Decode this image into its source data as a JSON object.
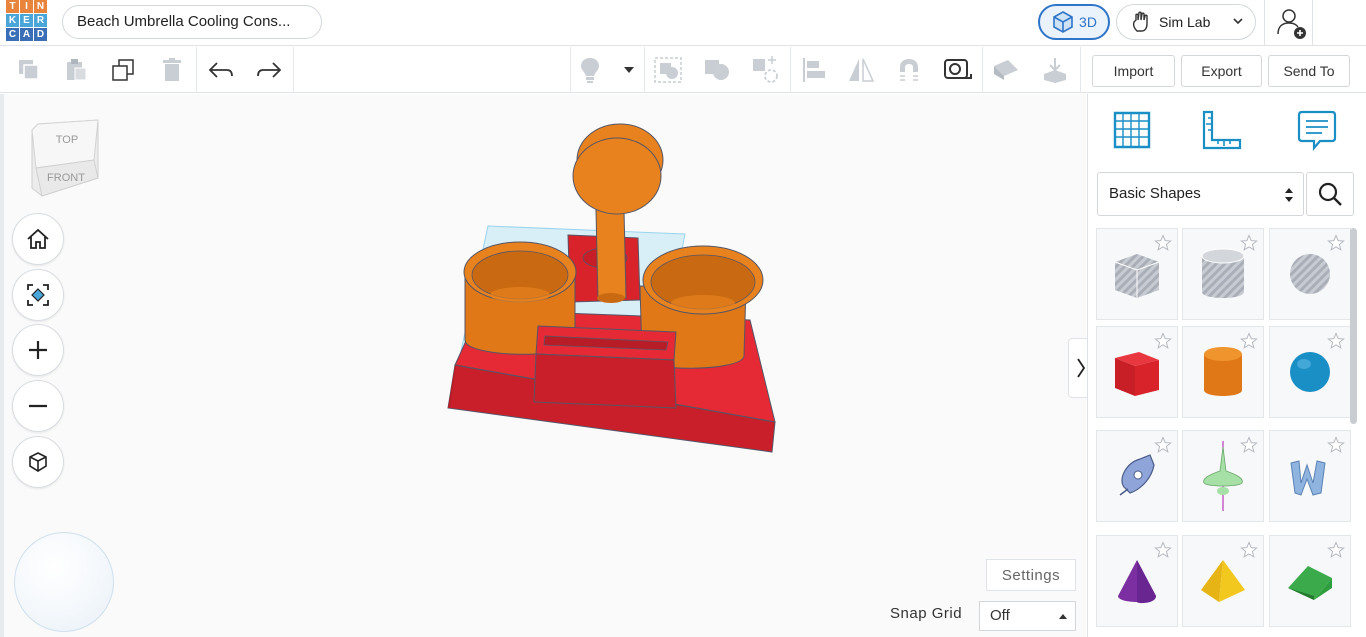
{
  "app": {
    "logo_letters": [
      "T",
      "I",
      "N",
      "K",
      "E",
      "R",
      "C",
      "A",
      "D"
    ],
    "logo_colors": [
      "#e8843c",
      "#e8843c",
      "#e8843c",
      "#4aa5d8",
      "#4aa5d8",
      "#4aa5d8",
      "#3a6fb7",
      "#3a6fb7",
      "#3a6fb7"
    ],
    "design_title": "Beach Umbrella Cooling Cons..."
  },
  "header": {
    "view_3d_label": "3D",
    "sim_lab_label": "Sim Lab",
    "icons": [
      "cube-icon",
      "hand-icon",
      "chevron-down-icon",
      "user-add-icon"
    ]
  },
  "toolbar": {
    "icons_left": [
      "copy-icon",
      "paste-icon",
      "duplicate-icon",
      "delete-icon",
      "undo-icon",
      "redo-icon"
    ],
    "icons_right": [
      "light-bulb-icon",
      "dropdown-caret-icon",
      "group-icon",
      "ungroup-icon",
      "cruise-icon",
      "align-icon",
      "mirror-icon",
      "magnet-icon",
      "ruler-icon",
      "note-icon",
      "drop-icon"
    ],
    "import_label": "Import",
    "export_label": "Export",
    "send_to_label": "Send To"
  },
  "viewcube": {
    "top_label": "TOP",
    "front_label": "FRONT"
  },
  "canvas": {
    "nav_buttons": [
      "home-view",
      "fit-view",
      "zoom-in",
      "zoom-out",
      "perspective"
    ],
    "settings_label": "Settings",
    "snap_grid_label": "Snap Grid",
    "snap_grid_value": "Off"
  },
  "panel": {
    "tabs": [
      "workplane-icon",
      "ruler-tool-icon",
      "notes-icon"
    ],
    "category": "Basic Shapes",
    "shapes": [
      {
        "name": "box-hole",
        "color": "#b8bcc4"
      },
      {
        "name": "cylinder-hole",
        "color": "#b8bcc4"
      },
      {
        "name": "sphere-hole",
        "color": "#b8bcc4"
      },
      {
        "name": "box",
        "color": "#d8232a"
      },
      {
        "name": "cylinder",
        "color": "#e8821e"
      },
      {
        "name": "sphere",
        "color": "#1a8fc6"
      },
      {
        "name": "scribble",
        "color": "#8fa4d8"
      },
      {
        "name": "shape-generator",
        "color": "#a6e0a6"
      },
      {
        "name": "text",
        "color": "#8fb4e0"
      },
      {
        "name": "cone",
        "color": "#7b2fa0"
      },
      {
        "name": "pyramid",
        "color": "#f2c81e"
      },
      {
        "name": "roof",
        "color": "#2e9e3e"
      }
    ]
  },
  "colors": {
    "accent": "#2e75c9",
    "red_shape": "#d8232a",
    "orange_shape": "#e8821e"
  }
}
